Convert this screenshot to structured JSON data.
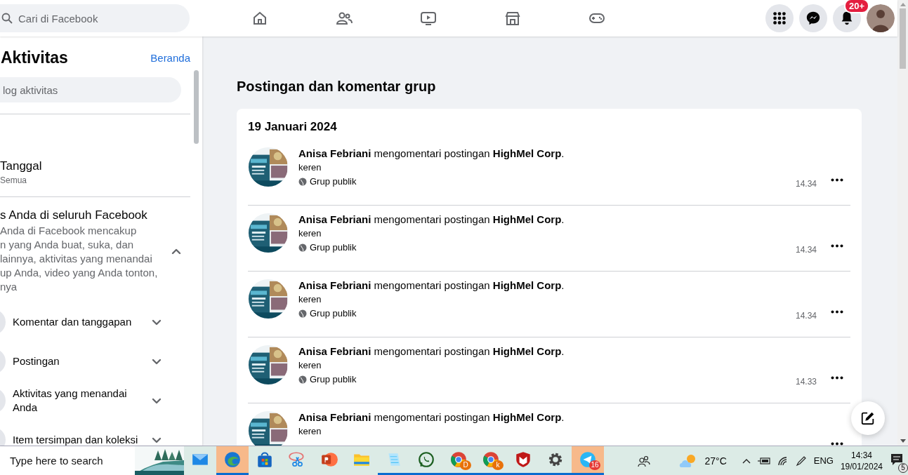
{
  "header": {
    "search": {
      "placeholder": "Cari di Facebook"
    },
    "nav": [
      {
        "kind": "home",
        "selected": false
      },
      {
        "kind": "friends",
        "selected": false
      },
      {
        "kind": "video",
        "selected": false
      },
      {
        "kind": "market",
        "selected": false
      },
      {
        "kind": "gaming",
        "selected": false
      }
    ],
    "actions": [
      {
        "kind": "menu"
      },
      {
        "kind": "messenger"
      },
      {
        "kind": "bell",
        "badge": "20+"
      }
    ]
  },
  "sidebar": {
    "title": "Aktivitas",
    "home_link": "Beranda",
    "search": {
      "placeholder": "log aktivitas"
    },
    "filter": {
      "title": "Tanggal",
      "value": "Semua"
    },
    "section": {
      "title": "s Anda di seluruh Facebook",
      "expanded": true,
      "description_lines": [
        "Anda di Facebook mencakup",
        "n yang Anda buat, suka, dan",
        "lainnya, aktivitas yang menandai",
        "up Anda, video yang Anda tonton,",
        "nya"
      ]
    },
    "items": [
      {
        "label": "Komentar dan tanggapan",
        "expanded": false
      },
      {
        "label": "Postingan",
        "expanded": false
      },
      {
        "label": "Aktivitas yang menandai Anda",
        "expanded": false
      },
      {
        "label": "Item tersimpan dan koleksi",
        "expanded": false
      }
    ]
  },
  "main": {
    "title": "Postingan dan komentar grup",
    "date": "19 Januari 2024",
    "rows": [
      {
        "actor": "Anisa Febriani",
        "action": "mengomentari postingan",
        "target": "HighMel Corp",
        "end": ".",
        "comment": "keren",
        "audience": "Grup publik",
        "time": "14.34"
      },
      {
        "actor": "Anisa Febriani",
        "action": "mengomentari postingan",
        "target": "HighMel Corp",
        "end": ".",
        "comment": "keren",
        "audience": "Grup publik",
        "time": "14.34"
      },
      {
        "actor": "Anisa Febriani",
        "action": "mengomentari postingan",
        "target": "HighMel Corp",
        "end": ".",
        "comment": "keren",
        "audience": "Grup publik",
        "time": "14.34"
      },
      {
        "actor": "Anisa Febriani",
        "action": "mengomentari postingan",
        "target": "HighMel Corp",
        "end": ".",
        "comment": "keren",
        "audience": "Grup publik",
        "time": "14.33"
      },
      {
        "actor": "Anisa Febriani",
        "action": "mengomentari postingan",
        "target": "HighMel Corp",
        "end": ".",
        "comment": "keren"
      }
    ]
  },
  "taskbar": {
    "search": {
      "placeholder": "Type here to search"
    },
    "apps": [
      {
        "kind": "mail",
        "selected": false,
        "running": false
      },
      {
        "kind": "edge",
        "selected": true,
        "running": true
      },
      {
        "kind": "store",
        "selected": false,
        "running": false
      },
      {
        "kind": "snip",
        "selected": false,
        "running": false
      },
      {
        "kind": "powerpoint",
        "selected": false,
        "running": false
      },
      {
        "kind": "folder",
        "selected": false,
        "running": false
      },
      {
        "kind": "notepad",
        "selected": false,
        "running": true
      },
      {
        "kind": "whatsapp",
        "selected": false,
        "running": true
      },
      {
        "kind": "chrome",
        "selected": false,
        "running": true,
        "badge": "D",
        "color": "#e8710a"
      },
      {
        "kind": "chrome",
        "selected": false,
        "running": true,
        "badge": "k",
        "color": "#e8710a"
      },
      {
        "kind": "shield",
        "selected": false,
        "running": true
      },
      {
        "kind": "gear",
        "selected": false,
        "running": true
      },
      {
        "kind": "telegram",
        "selected": true,
        "running": true,
        "badge": "16",
        "color": "#e53935"
      }
    ],
    "weather": "27°C",
    "language": "ENG",
    "time": "14:34",
    "date": "19/01/2024",
    "notifications": "5"
  }
}
